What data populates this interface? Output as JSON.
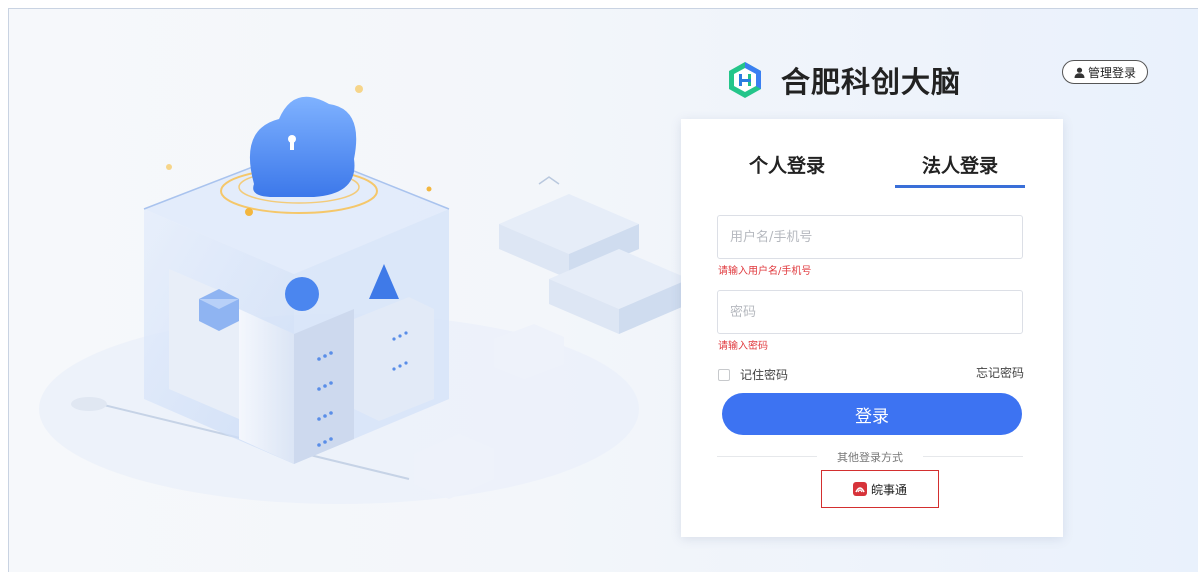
{
  "brand": {
    "name": "合肥科创大脑",
    "logo_icon": "hf-logo-icon"
  },
  "header": {
    "admin_login_label": "管理登录",
    "admin_icon": "user-icon"
  },
  "login": {
    "tabs": [
      {
        "label": "个人登录",
        "active": false
      },
      {
        "label": "法人登录",
        "active": true
      }
    ],
    "username": {
      "placeholder": "用户名/手机号",
      "value": "",
      "error": "请输入用户名/手机号"
    },
    "password": {
      "placeholder": "密码",
      "value": "",
      "error": "请输入密码"
    },
    "remember_label": "记住密码",
    "forgot_label": "忘记密码",
    "submit_label": "登录",
    "other_methods_label": "其他登录方式",
    "wanshitong_label": "皖事通",
    "wanshitong_icon": "wanshitong-icon"
  },
  "colors": {
    "accent": "#3d73f2",
    "error": "#e0393e",
    "highlight_border": "#d32f2f"
  }
}
